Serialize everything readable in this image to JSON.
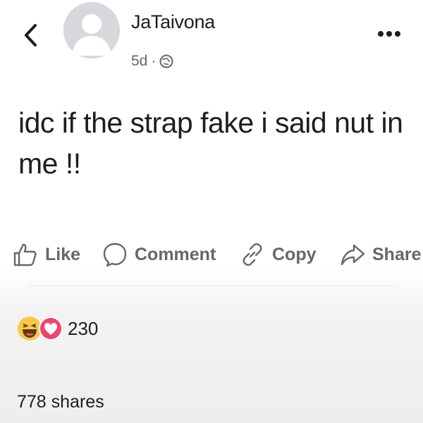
{
  "post": {
    "author": "JaTaivona",
    "time": "5d",
    "separator": "·",
    "privacy_icon": "globe-icon",
    "text": "idc if the strap fake i said nut in me !!"
  },
  "actions": {
    "like_label": "Like",
    "comment_label": "Comment",
    "copy_label": "Copy",
    "share_label": "Share"
  },
  "stats": {
    "reaction_icons": [
      "haha-icon",
      "love-icon"
    ],
    "reaction_count": "230",
    "shares": "778 shares"
  },
  "colors": {
    "text_primary": "#1c1e21",
    "text_secondary": "#65676b",
    "haha_yellow": "#f7c948",
    "love_pink": "#f0436b",
    "avatar_gray": "#d6d8db"
  }
}
